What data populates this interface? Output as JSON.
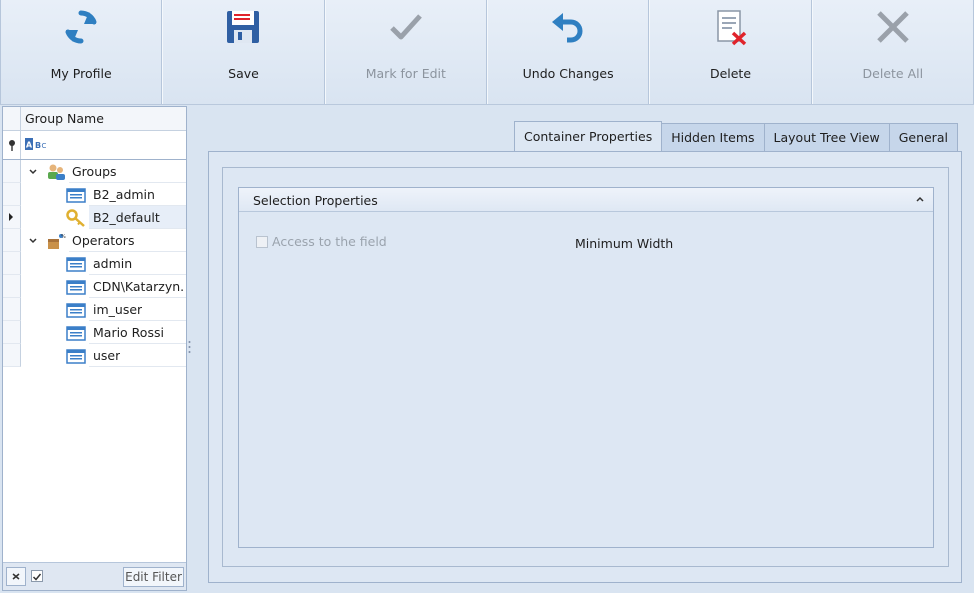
{
  "toolbar": {
    "buttons": [
      {
        "label": "My Profile",
        "icon": "refresh-icon",
        "enabled": true
      },
      {
        "label": "Save",
        "icon": "floppy-disk-icon",
        "enabled": true
      },
      {
        "label": "Mark for Edit",
        "icon": "checkmark-icon",
        "enabled": false
      },
      {
        "label": "Undo Changes",
        "icon": "undo-arrow-icon",
        "enabled": true
      },
      {
        "label": "Delete",
        "icon": "delete-document-icon",
        "enabled": true
      },
      {
        "label": "Delete All",
        "icon": "x-icon",
        "enabled": false
      }
    ]
  },
  "left_panel": {
    "column_header": "Group Name",
    "filter_row_icon": "abc-filter-icon",
    "tree": [
      {
        "label": "Groups",
        "level": 0,
        "icon": "users-group-icon",
        "expanded": true
      },
      {
        "label": "B2_admin",
        "level": 1,
        "icon": "record-icon"
      },
      {
        "label": "B2_default",
        "level": 1,
        "icon": "key-icon",
        "selected": true
      },
      {
        "label": "Operators",
        "level": 0,
        "icon": "operators-icon",
        "expanded": true
      },
      {
        "label": "admin",
        "level": 1,
        "icon": "record-icon"
      },
      {
        "label": "CDN\\Katarzyn...",
        "level": 1,
        "icon": "record-icon"
      },
      {
        "label": "im_user",
        "level": 1,
        "icon": "record-icon"
      },
      {
        "label": "Mario Rossi",
        "level": 1,
        "icon": "record-icon"
      },
      {
        "label": "user",
        "level": 1,
        "icon": "record-icon"
      }
    ],
    "footer": {
      "edit_filter_label": "Edit Filter",
      "filter_enabled": true
    }
  },
  "tabs": [
    {
      "label": "Container Properties",
      "active": true
    },
    {
      "label": "Hidden Items",
      "active": false
    },
    {
      "label": "Layout Tree View",
      "active": false
    },
    {
      "label": "General",
      "active": false
    }
  ],
  "selection_properties": {
    "header": "Selection Properties",
    "access_field_label": "Access to the field",
    "access_field_checked": false,
    "minimum_width_label": "Minimum Width"
  },
  "colors": {
    "toolbar_bg": "#dfe8f4",
    "panel_bg": "#d9e4f1",
    "border": "#9fb2cc",
    "icon_blue": "#2f7fc1",
    "icon_red": "#e0232b",
    "disabled_gray": "#8c949e"
  }
}
